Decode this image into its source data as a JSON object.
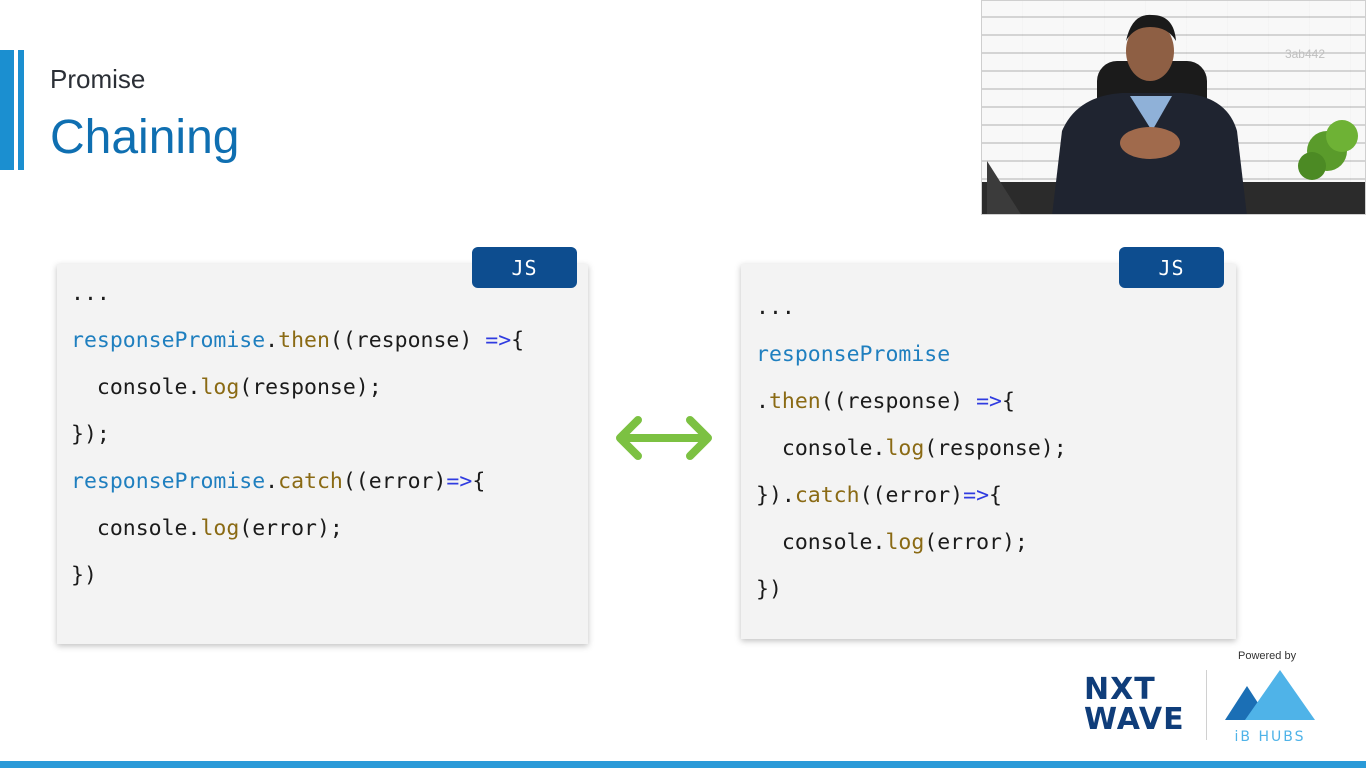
{
  "slide": {
    "subtitle": "Promise",
    "title": "Chaining"
  },
  "video_overlay": {
    "id_text": "3ab442"
  },
  "left_panel": {
    "badge": "JS",
    "lines": [
      "...",
      "responsePromise.then((response) =>{",
      "  console.log(response);",
      "});",
      "",
      "responsePromise.catch((error)=>{",
      "  console.log(error);",
      "})"
    ]
  },
  "right_panel": {
    "badge": "JS",
    "lines": [
      "...",
      "responsePromise",
      ".then((response) =>{",
      "  console.log(response);",
      "}).catch((error)=>{",
      "  console.log(error);",
      "})"
    ]
  },
  "branding": {
    "powered_by": "Powered by",
    "nxtwave_line1": "NXT",
    "nxtwave_line2": "WAVE",
    "ib_hubs": "iB HUBS"
  },
  "colors": {
    "title": "#0f6fb1",
    "accent": "#1b8fd0",
    "badge": "#0d4d8f",
    "arrow": "#7cc142",
    "code_identifier": "#1f7fbf",
    "code_method": "#8a6a14",
    "code_keyword": "#2f3be0"
  },
  "icons": {
    "arrow": "double-headed-arrow-icon"
  }
}
